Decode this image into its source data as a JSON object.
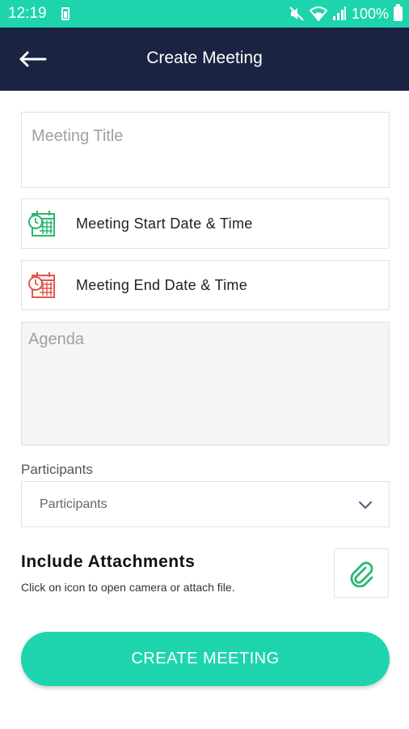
{
  "status_bar": {
    "time": "12:19",
    "battery": "100%",
    "icons": [
      "battery-saver-icon",
      "mute-icon",
      "wifi-icon",
      "signal-icon",
      "battery-icon"
    ]
  },
  "header": {
    "title": "Create Meeting",
    "back_icon": "arrow-left-icon"
  },
  "form": {
    "title_placeholder": "Meeting Title",
    "start_label": "Meeting Start Date & Time",
    "end_label": "Meeting End Date & Time",
    "agenda_placeholder": "Agenda",
    "participants_label": "Participants",
    "participants_value": "Participants"
  },
  "attachments": {
    "title": "Include Attachments",
    "subtitle": "Click on icon to open camera or attach file.",
    "icon": "paperclip-icon"
  },
  "actions": {
    "create_label": "CREATE MEETING"
  },
  "colors": {
    "accent": "#1ed4ad",
    "header": "#1a2342",
    "start_icon": "#2bb673",
    "end_icon": "#e0574f"
  }
}
